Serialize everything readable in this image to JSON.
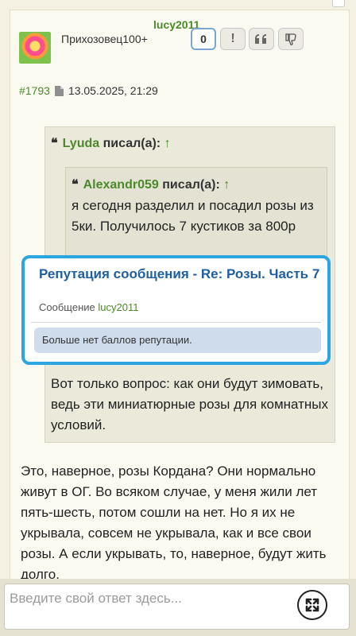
{
  "post": {
    "username": "lucy2011",
    "rank": "Прихозовец100+",
    "reputation_count": "0",
    "report_label": "!",
    "post_number": "#1793",
    "date": "13.05.2025, 21:29"
  },
  "quote_outer": {
    "author": "Lyuda",
    "wrote_label": "писал(а):",
    "arrow": "↑",
    "text_after": "Вот только вопрос: как они будут зимовать, ведь эти миниатюрные розы для комнатных условий."
  },
  "quote_inner": {
    "author": "Alexandr059",
    "wrote_label": "писал(а):",
    "arrow": "↑",
    "text": "я сегодня разделил и посадил розы из 5ки. Получилось 7 кустиков за 800р"
  },
  "body_text": "Это, наверное, розы Кордана? Они нормально живут в ОГ. Во всяком случае, у меня жили лет пять-шесть, потом сошли на нет. Но я их не укрывала, совсем не укрывала, как и все свои розы. А если укрывать, то, наверное, будут жить долго.",
  "popup": {
    "title": "Репутация сообщения - Re: Розы. Часть 7",
    "sub_label": "Сообщение",
    "sub_user": "lucy2011",
    "notice": "Больше нет баллов репутации."
  },
  "reply": {
    "placeholder": "Введите свой ответ здесь..."
  },
  "colors": {
    "accent_blue": "#2ba6e0",
    "username_green": "#4a8a2a",
    "title_blue": "#1f5fa0"
  },
  "icons": [
    "document-icon",
    "quote-icon",
    "thumbs-down-icon",
    "expand-icon",
    "up-arrow-icon"
  ]
}
